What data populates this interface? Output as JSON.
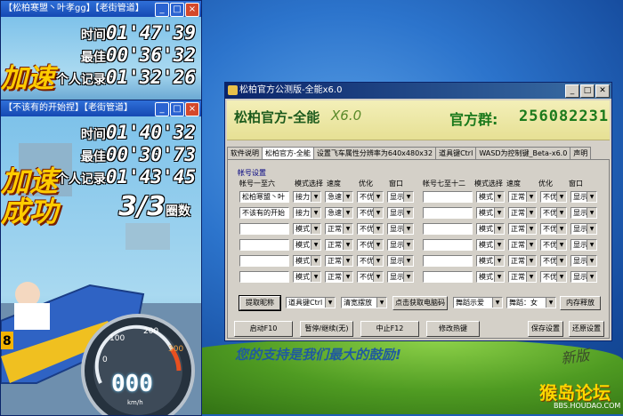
{
  "game_window_1": {
    "title": "【松柏寒盟丶叶孝gg】【老街管道】",
    "times": [
      {
        "label": "时间",
        "value": "01'47'39"
      },
      {
        "label": "最佳",
        "value": "00'36'32"
      },
      {
        "label": "个人记录",
        "value": "01'32'26"
      }
    ]
  },
  "game_window_2": {
    "title": "【不该有的开始捏】【老街管道】",
    "times": [
      {
        "label": "时间",
        "value": "01'40'32"
      },
      {
        "label": "最佳",
        "value": "00'30'73"
      },
      {
        "label": "个人记录",
        "value": "01'43'45"
      }
    ],
    "lap": "3/3",
    "lap_unit": "圈数",
    "speed": "000",
    "speed_unit": "km/h",
    "gauge_ticks": [
      "0",
      "100",
      "200",
      "300"
    ]
  },
  "app": {
    "title": "松柏官方公测版-全能x6.0",
    "banner_title": "松柏官方-全能",
    "banner_version": "X6.0",
    "banner_qq_label": "官方群:",
    "banner_qq": "256082231",
    "tabs": [
      "软件说明",
      "松柏官方-全能",
      "设置飞车属性分辨率为640x480x32",
      "道具键Ctrl",
      "WASD为控制键_Beta-x6.0",
      "声明"
    ],
    "active_tab": 1,
    "group_label": "帐号设置",
    "headers_left": [
      "帐号一至六",
      "模式选择",
      "速度",
      "优化",
      "窗口"
    ],
    "headers_right": [
      "帐号七至十二",
      "模式选择",
      "速度",
      "优化",
      "窗口"
    ],
    "rows_left": [
      {
        "account": "松柏寒盟丶叶",
        "mode": "接力",
        "speed": "急速",
        "opt": "不优",
        "win": "显示"
      },
      {
        "account": "不该有的开始",
        "mode": "接力",
        "speed": "急速",
        "opt": "不优",
        "win": "显示"
      },
      {
        "account": "",
        "mode": "模式",
        "speed": "正常",
        "opt": "不优",
        "win": "显示"
      },
      {
        "account": "",
        "mode": "模式",
        "speed": "正常",
        "opt": "不优",
        "win": "显示"
      },
      {
        "account": "",
        "mode": "模式",
        "speed": "正常",
        "opt": "不优",
        "win": "显示"
      },
      {
        "account": "",
        "mode": "模式",
        "speed": "正常",
        "opt": "不优",
        "win": "显示"
      }
    ],
    "rows_right": [
      {
        "account": "",
        "mode": "模式",
        "speed": "正常",
        "opt": "不优",
        "win": "显示"
      },
      {
        "account": "",
        "mode": "模式",
        "speed": "正常",
        "opt": "不优",
        "win": "显示"
      },
      {
        "account": "",
        "mode": "模式",
        "speed": "正常",
        "opt": "不优",
        "win": "显示"
      },
      {
        "account": "",
        "mode": "模式",
        "speed": "正常",
        "opt": "不优",
        "win": "显示"
      },
      {
        "account": "",
        "mode": "模式",
        "speed": "正常",
        "opt": "不优",
        "win": "显示"
      },
      {
        "account": "",
        "mode": "模式",
        "speed": "正常",
        "opt": "不优",
        "win": "显示"
      }
    ],
    "toolbar1": {
      "fetch_names": "提取昵称",
      "prop_key": "道具键Ctrl",
      "clear_swing": "清宽摆放",
      "fetch_captcha": "点击获取电脑码",
      "dance_show": "舞蹈示爱",
      "dance_gender": "舞蹈：女",
      "memory_release": "内存释放"
    },
    "toolbar2": {
      "start": "启动F10",
      "pause": "暂停/继续(无)",
      "stop": "中止F12",
      "hotkey": "修改热键",
      "save": "保存设置",
      "restore": "还原设置"
    },
    "footer": "您的支持是我们最大的鼓励!"
  },
  "watermark": {
    "main": "猴岛论坛",
    "sub": "BBS.HOUDAO.COM",
    "signature": "新版"
  }
}
